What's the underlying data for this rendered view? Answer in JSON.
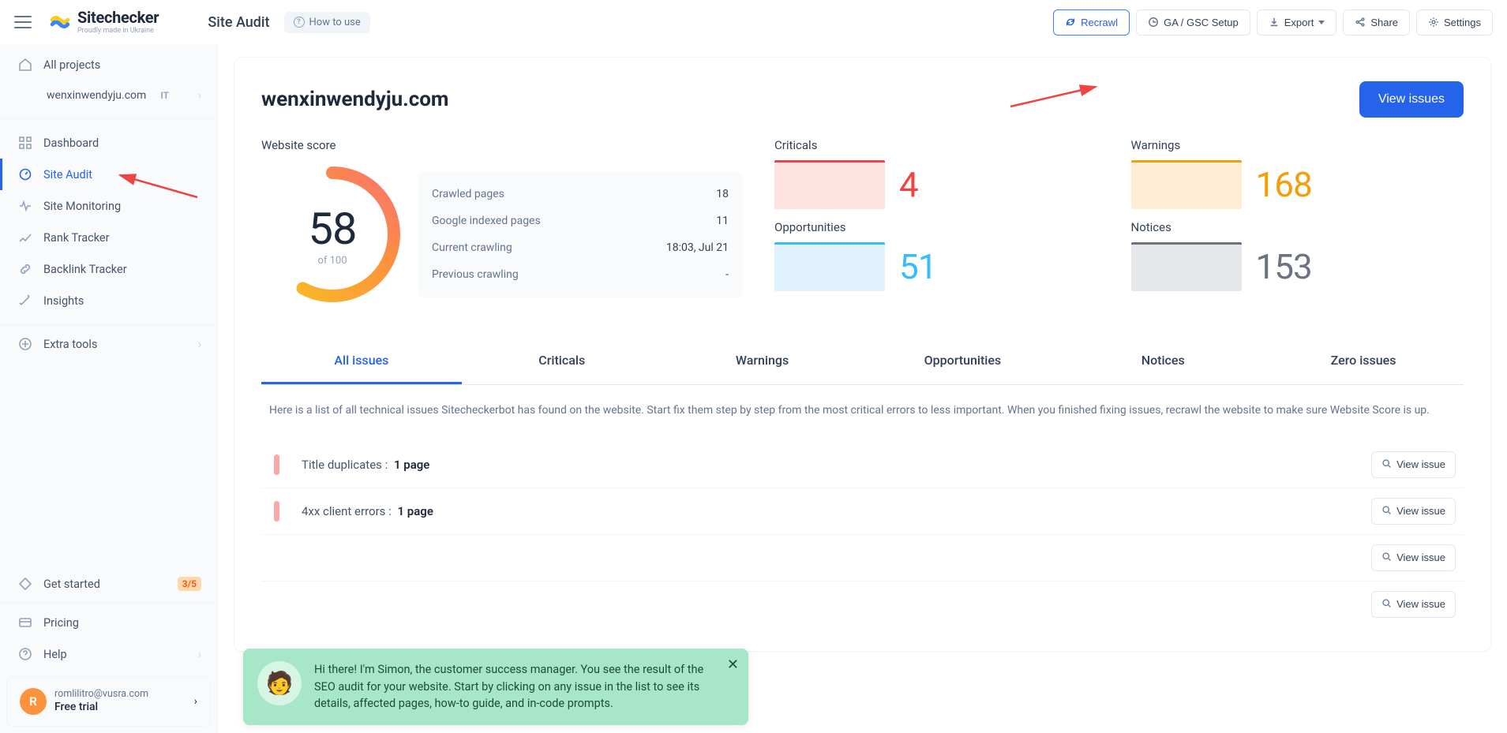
{
  "brand": {
    "name": "Sitechecker",
    "tagline": "Proudly made in Ukraine"
  },
  "top": {
    "title": "Site Audit",
    "howto": "How to use",
    "actions": {
      "recrawl": "Recrawl",
      "ga": "GA / GSC Setup",
      "export": "Export",
      "share": "Share",
      "settings": "Settings"
    }
  },
  "sidebar": {
    "all_projects": "All projects",
    "project": {
      "name": "wenxinwendyju.com",
      "tag": "IT"
    },
    "items": {
      "dashboard": "Dashboard",
      "site_audit": "Site Audit",
      "site_monitoring": "Site Monitoring",
      "rank_tracker": "Rank Tracker",
      "backlink_tracker": "Backlink Tracker",
      "insights": "Insights",
      "extra_tools": "Extra tools",
      "get_started": "Get started",
      "get_started_badge": "3/5",
      "pricing": "Pricing",
      "help": "Help"
    },
    "account": {
      "email": "romlilitro@vusra.com",
      "plan": "Free trial",
      "initial": "R"
    }
  },
  "card": {
    "domain": "wenxinwendyju.com",
    "view_issues": "View issues",
    "score": {
      "title": "Website score",
      "value": "58",
      "of": "of 100",
      "rows": [
        {
          "label": "Crawled pages",
          "value": "18"
        },
        {
          "label": "Google indexed pages",
          "value": "11"
        },
        {
          "label": "Current crawling",
          "value": "18:03, Jul 21"
        },
        {
          "label": "Previous crawling",
          "value": "-"
        }
      ]
    },
    "stats": {
      "criticals": {
        "label": "Criticals",
        "value": "4"
      },
      "warnings": {
        "label": "Warnings",
        "value": "168"
      },
      "opportunities": {
        "label": "Opportunities",
        "value": "51"
      },
      "notices": {
        "label": "Notices",
        "value": "153"
      }
    },
    "tabs": {
      "all": "All issues",
      "crit": "Criticals",
      "warn": "Warnings",
      "opp": "Opportunities",
      "not": "Notices",
      "zero": "Zero issues",
      "desc": "Here is a list of all technical issues Sitecheckerbot has found on the website. Start fix them step by step from the most critical errors to less important. When you finished fixing issues, recrawl the website to make sure Website Score is up."
    },
    "issues": [
      {
        "name": "Title duplicates :",
        "count": "1 page"
      },
      {
        "name": "4xx client errors :",
        "count": "1 page"
      },
      {
        "name": "",
        "count": ""
      },
      {
        "name": "",
        "count": ""
      }
    ],
    "view_issue_btn": "View issue"
  },
  "toast": {
    "msg": "Hi there! I'm Simon, the customer success manager. You see the result of the SEO audit for your website. Start by clicking on any issue in the list to see its details, affected pages, how-to guide, and in-code prompts."
  }
}
